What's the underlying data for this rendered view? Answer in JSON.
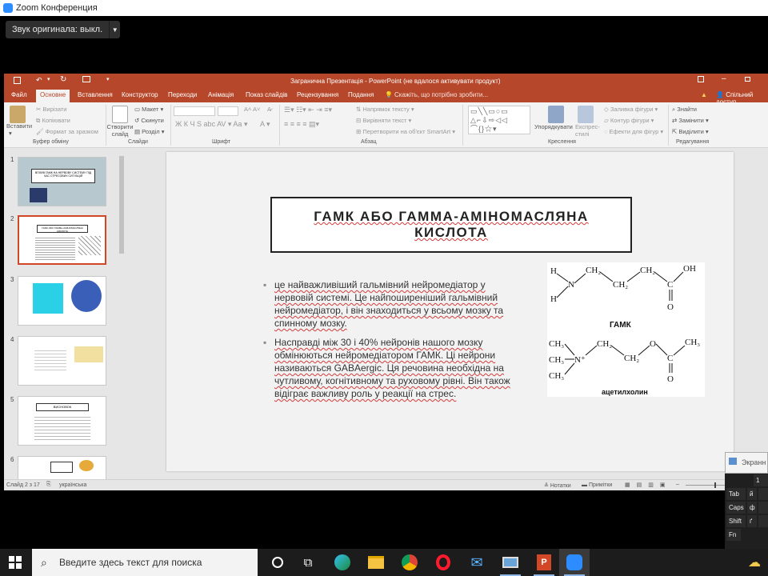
{
  "zoom": {
    "title": "Zoom Конференция",
    "original_sound": "Звук оригинала: выкл."
  },
  "ppt": {
    "window_title": "Загранична Презентація - PowerPoint (не вдалося активувати продукт)",
    "tabs": [
      "Файл",
      "Основне",
      "Вставлення",
      "Конструктор",
      "Переходи",
      "Анімація",
      "Показ слайдів",
      "Рецензування",
      "Подання"
    ],
    "tell_me": "Скажіть, що потрібно зробити...",
    "share": "Спільний доступ",
    "ribbon": {
      "paste": "Вставити",
      "cut": "Вирізати",
      "copy": "Копіювати",
      "format_painter": "Формат за зразком",
      "clipboard_group": "Буфер обміну",
      "new_slide": "Створити слайд",
      "layout": "Макет",
      "reset": "Скинути",
      "section": "Розділ",
      "slides_group": "Слайди",
      "font_group": "Шрифт",
      "text_direction": "Напрямок тексту",
      "align_text": "Вирівняти текст",
      "smartart": "Перетворити на об'єкт SmartArt",
      "paragraph_group": "Абзац",
      "arrange": "Упорядкувати",
      "quick_styles": "Експрес-стилі",
      "shape_fill": "Заливка фігури",
      "shape_outline": "Контур фігури",
      "shape_effects": "Ефекти для фігур",
      "drawing_group": "Креслення",
      "find": "Знайти",
      "replace": "Замінити",
      "select": "Виділити",
      "editing_group": "Редагування"
    },
    "thumbnails": [
      {
        "num": "1",
        "caption": "ВПЛИВ ГАМК НА НЕРВОВУ СИСТЕМУ ПІД ЧАС СТРЕСОВИХ СИТУАЦІЙ"
      },
      {
        "num": "2",
        "caption": "ГАМК АБО ГАММА-АМІНОМАСЛЯНА КИСЛОТА"
      },
      {
        "num": "3",
        "caption": ""
      },
      {
        "num": "4",
        "caption": ""
      },
      {
        "num": "5",
        "caption": "ВИСНОВОК"
      },
      {
        "num": "6",
        "caption": ""
      }
    ],
    "slide": {
      "title": "ГАМК АБО ГАММА-АМІНОМАСЛЯНА КИСЛОТА",
      "bullets": [
        "це найважливіший гальмівний нейромедіатор у нервовій системі. Це найпоширеніший гальмівний нейромедіатор, і він знаходиться у всьому мозку та спинному мозку.",
        "Насправді між 30 і 40% нейронів нашого мозку обмінюються нейромедіатором ГАМК. Ці нейрони називаються GABAergic. Ця речовина необхідна на чутливому, когнітивному та руховому рівні. Він також відіграє важливу роль у реакції на стрес."
      ],
      "chem_label_1": "ГАМК",
      "chem_label_2": "ацетилхолин"
    },
    "status": {
      "slide_of": "Слайд 2 з 17",
      "language": "українська",
      "notes": "Нотатки",
      "comments": "Примітки"
    }
  },
  "keyboard": {
    "header": "Экранн",
    "keys": [
      "Tab",
      "Caps",
      "Shift",
      "Fn"
    ]
  },
  "taskbar": {
    "search_placeholder": "Введите здесь текст для поиска"
  }
}
